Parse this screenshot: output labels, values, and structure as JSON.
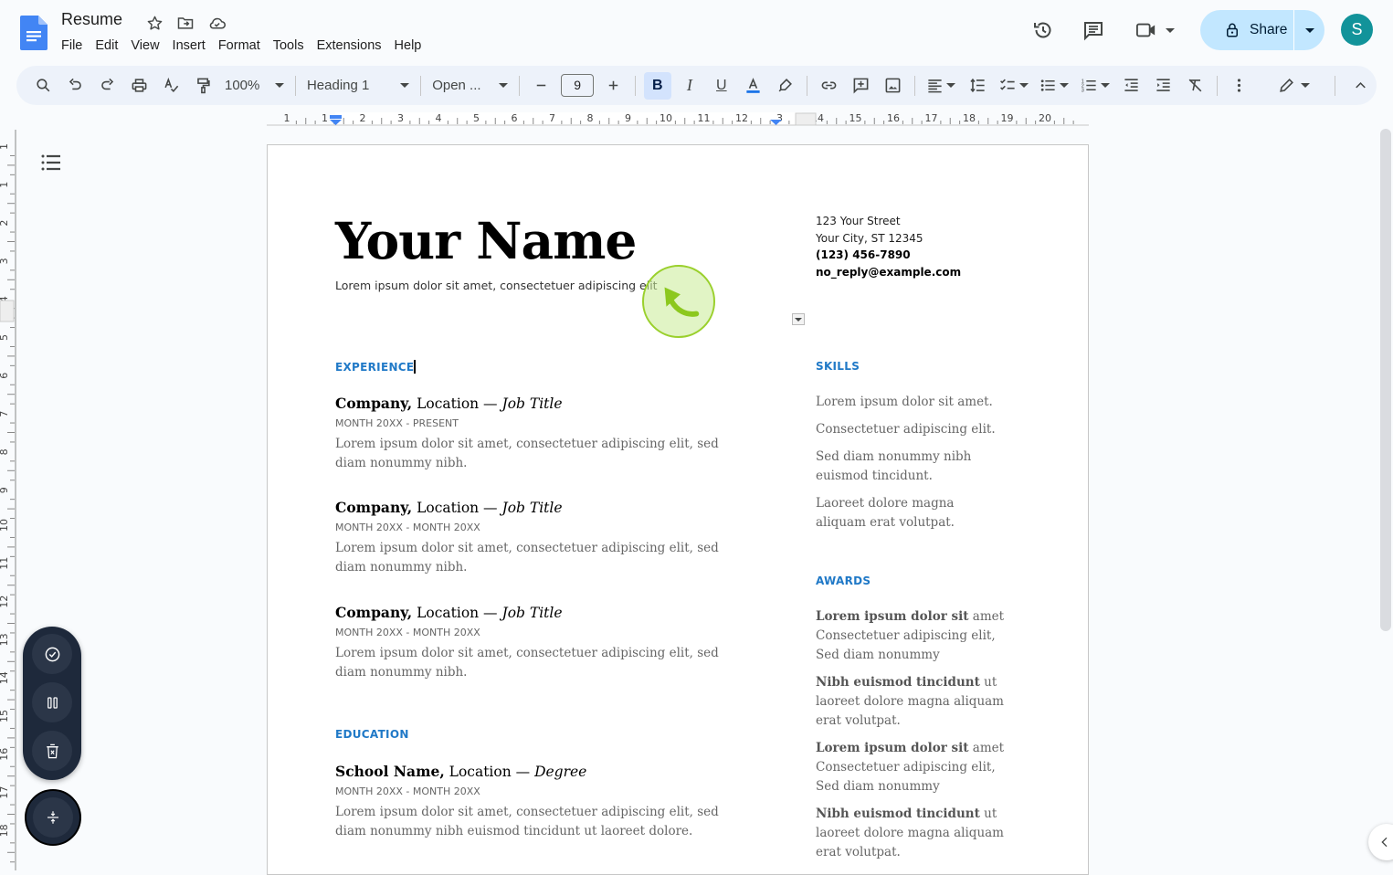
{
  "app": {
    "doc_title": "Resume",
    "menu": [
      "File",
      "Edit",
      "View",
      "Insert",
      "Format",
      "Tools",
      "Extensions",
      "Help"
    ],
    "share_label": "Share",
    "avatar_initial": "S",
    "icons": {
      "logo": "google-docs-icon",
      "star": "star-icon",
      "move": "move-to-folder-icon",
      "cloud": "cloud-saved-icon",
      "history": "version-history-icon",
      "comments": "comments-icon",
      "meet": "video-call-icon",
      "lock": "lock-icon"
    }
  },
  "toolbar": {
    "zoom": "100%",
    "style": "Heading 1",
    "font": "Open ...",
    "font_size": "9",
    "bold_active": true,
    "text_color": "#1a73e8"
  },
  "ruler": {
    "h_labels": [
      "1",
      "1",
      "2",
      "3",
      "4",
      "5",
      "6",
      "7",
      "8",
      "9",
      "10",
      "11",
      "12",
      "3",
      "14",
      "15",
      "16",
      "17",
      "18",
      "19",
      "20"
    ],
    "v_labels": [
      "1",
      "1",
      "2",
      "3",
      "4",
      "5",
      "6",
      "7",
      "8",
      "9",
      "10",
      "11",
      "12",
      "13",
      "14",
      "15",
      "16",
      "17",
      "18"
    ]
  },
  "document": {
    "name": "Your Name",
    "subtitle": "Lorem ipsum dolor sit amet, consectetuer adipiscing elit",
    "address": {
      "street": "123 Your Street",
      "city": "Your City, ST 12345",
      "phone": "(123) 456-7890",
      "email": "no_reply@example.com"
    },
    "experience_heading": "EXPERIENCE",
    "jobs": [
      {
        "company": "Company,",
        "location": " Location — ",
        "title": "Job Title",
        "date": "MONTH 20XX - PRESENT",
        "desc": "Lorem ipsum dolor sit amet, consectetuer adipiscing elit, sed diam nonummy nibh."
      },
      {
        "company": "Company,",
        "location": " Location — ",
        "title": "Job Title",
        "date": "MONTH 20XX - MONTH 20XX",
        "desc": "Lorem ipsum dolor sit amet, consectetuer adipiscing elit, sed diam nonummy nibh."
      },
      {
        "company": "Company,",
        "location": " Location — ",
        "title": "Job Title",
        "date": "MONTH 20XX - MONTH 20XX",
        "desc": "Lorem ipsum dolor sit amet, consectetuer adipiscing elit, sed diam nonummy nibh."
      }
    ],
    "education_heading": "EDUCATION",
    "education": [
      {
        "school": "School Name,",
        "location": " Location — ",
        "degree": "Degree",
        "date": "MONTH 20XX - MONTH 20XX",
        "desc": "Lorem ipsum dolor sit amet, consectetuer adipiscing elit, sed diam nonummy nibh euismod tincidunt ut laoreet dolore."
      }
    ],
    "skills_heading": "SKILLS",
    "skills": [
      "Lorem ipsum dolor sit amet.",
      "Consectetuer adipiscing elit.",
      "Sed diam nonummy nibh euismod tincidunt.",
      "Laoreet dolore magna aliquam erat volutpat."
    ],
    "awards_heading": "AWARDS",
    "awards": [
      {
        "bold": "Lorem ipsum dolor sit",
        "rest": " amet Consectetuer adipiscing elit, Sed diam nonummy"
      },
      {
        "bold": "Nibh euismod tincidunt",
        "rest": " ut laoreet dolore magna aliquam erat volutpat."
      },
      {
        "bold": "Lorem ipsum dolor sit",
        "rest": " amet Consectetuer adipiscing elit, Sed diam nonummy"
      },
      {
        "bold": "Nibh euismod tincidunt",
        "rest": " ut laoreet dolore magna aliquam erat volutpat."
      }
    ]
  },
  "recorder_widget": {
    "buttons": [
      "check-icon",
      "pause-icon",
      "discard-icon"
    ],
    "collapse": "collapse-icon"
  },
  "colors": {
    "accent": "#2079c7",
    "share_bg": "#c2e7ff",
    "avatar_bg": "#12939a",
    "click_indicator": "#9ad02c"
  }
}
